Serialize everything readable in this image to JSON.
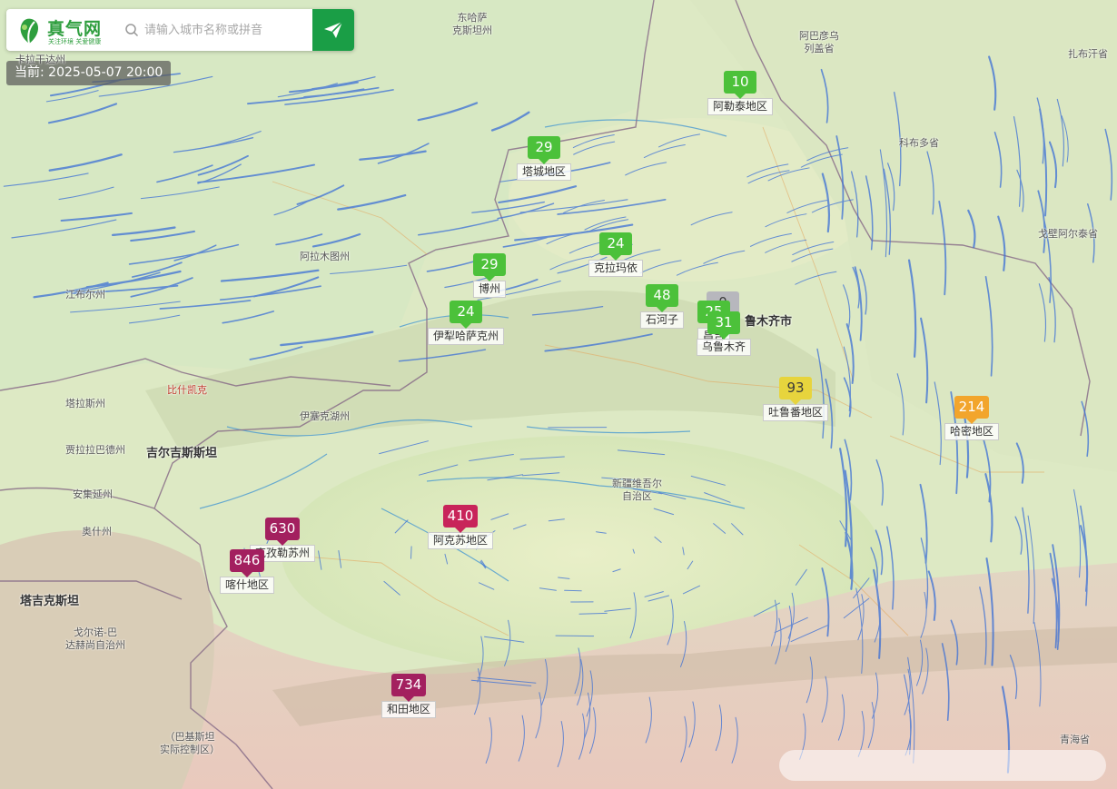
{
  "header": {
    "logo_text": "真气网",
    "logo_slogan": "关注环境 关爱健康",
    "search_placeholder": "请输入城市名称或拼音",
    "time_label": "当前: 2025-05-07 20:00"
  },
  "stations": [
    {
      "name": "阿勒泰地区",
      "aqi": "10",
      "color": "#4cc13a"
    },
    {
      "name": "塔城地区",
      "aqi": "29",
      "color": "#4cc13a"
    },
    {
      "name": "克拉玛依",
      "aqi": "24",
      "color": "#4cc13a"
    },
    {
      "name": "博州",
      "aqi": "29",
      "color": "#4cc13a"
    },
    {
      "name": "伊犁哈萨克州",
      "aqi": "24",
      "color": "#4cc13a"
    },
    {
      "name": "石河子",
      "aqi": "48",
      "color": "#4cc13a"
    },
    {
      "name": "昌吉",
      "aqi": "25",
      "color": "#4cc13a"
    },
    {
      "name": "乌鲁木齐",
      "aqi": "31",
      "color": "#4cc13a"
    },
    {
      "name": "",
      "aqi": "0",
      "color": "#b7b7bd"
    },
    {
      "name": "吐鲁番地区",
      "aqi": "93",
      "color": "#e7d43d"
    },
    {
      "name": "哈密地区",
      "aqi": "214",
      "color": "#f2a52c"
    },
    {
      "name": "克孜勒苏州",
      "aqi": "630",
      "color": "#a3205f"
    },
    {
      "name": "喀什地区",
      "aqi": "846",
      "color": "#a3205f"
    },
    {
      "name": "阿克苏地区",
      "aqi": "410",
      "color": "#c8245a"
    },
    {
      "name": "和田地区",
      "aqi": "734",
      "color": "#a3205f"
    }
  ],
  "map_labels": [
    {
      "text": "东哈萨\n克斯坦州",
      "style": "normal"
    },
    {
      "text": "阿巴彦乌\n列盖省",
      "style": "normal"
    },
    {
      "text": "扎布汗省",
      "style": "normal"
    },
    {
      "text": "科布多省",
      "style": "normal"
    },
    {
      "text": "戈壁阿尔泰省",
      "style": "normal"
    },
    {
      "text": "阿拉木图州",
      "style": "normal"
    },
    {
      "text": "江布尔州",
      "style": "normal"
    },
    {
      "text": "卡拉干达州",
      "style": "normal"
    },
    {
      "text": "比什凯克",
      "style": "red"
    },
    {
      "text": "塔拉斯州",
      "style": "normal"
    },
    {
      "text": "伊塞克湖州",
      "style": "normal"
    },
    {
      "text": "贾拉拉巴德州",
      "style": "normal"
    },
    {
      "text": "吉尔吉斯斯坦",
      "style": "big"
    },
    {
      "text": "安集延州",
      "style": "normal"
    },
    {
      "text": "奥什州",
      "style": "normal"
    },
    {
      "text": "塔吉克斯坦",
      "style": "big"
    },
    {
      "text": "戈尔诺-巴\n达赫尚自治州",
      "style": "normal"
    },
    {
      "text": "（巴基斯坦\n实际控制区）",
      "style": "normal"
    },
    {
      "text": "新疆维吾尔\n自治区",
      "style": "normal"
    },
    {
      "text": "鲁木齐市",
      "style": "big"
    },
    {
      "text": "青海省",
      "style": "normal"
    }
  ],
  "colors": {
    "brand_green": "#1a9e46",
    "wind_line": "#3b6fd6",
    "terrain_base": "#dfe9c8",
    "desert": "#e7ecc9",
    "mountains": "#d9c9b4"
  }
}
